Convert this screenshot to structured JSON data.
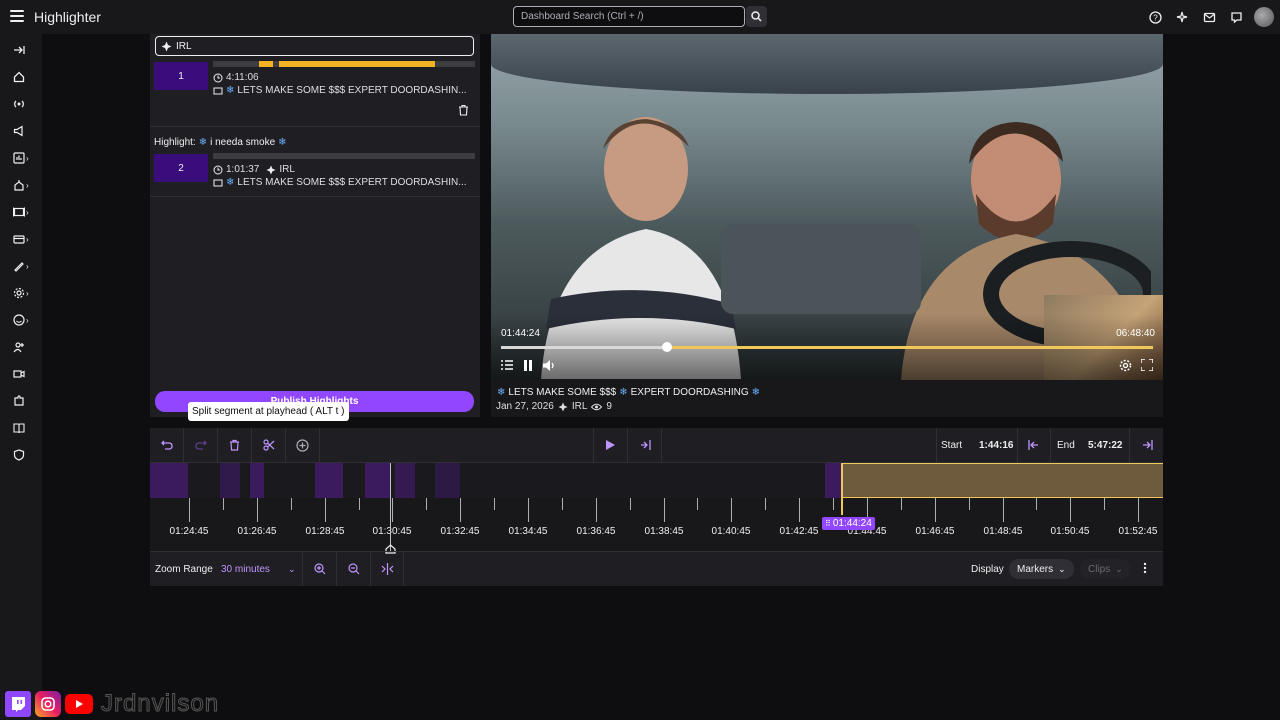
{
  "app": {
    "title": "Highlighter"
  },
  "search": {
    "placeholder": "Dashboard Search (Ctrl + /)"
  },
  "highlights": {
    "group_label": "IRL",
    "items": [
      {
        "number": "1",
        "title": "",
        "duration": "4:11:06",
        "category": "",
        "stream_title": "LETS MAKE SOME $$$  EXPERT DOORDASHIN..."
      },
      {
        "number": "2",
        "title": "i needa smoke",
        "title_prefix": "Highlight:",
        "duration": "1:01:37",
        "category": "IRL",
        "stream_title": "LETS MAKE SOME $$$  EXPERT DOORDASHIN..."
      }
    ],
    "publish_label": "Publish Highlights",
    "tooltip": "Split segment at playhead ( ALT t )"
  },
  "player": {
    "current_time": "01:44:24",
    "total_time": "06:48:40",
    "progress_fraction": 0.255
  },
  "video_info": {
    "title_a": "LETS MAKE SOME $$$",
    "title_b": "EXPERT DOORDASHING",
    "date": "Jan 27, 2026",
    "category": "IRL",
    "viewers": "9"
  },
  "editor": {
    "start_label": "Start",
    "start_value": "1:44:16",
    "end_label": "End",
    "end_value": "5:47:22"
  },
  "timeline": {
    "ticks": [
      "01:24:45",
      "01:26:45",
      "01:28:45",
      "01:30:45",
      "01:32:45",
      "01:34:45",
      "01:36:45",
      "01:38:45",
      "01:40:45",
      "01:42:45",
      "01:44:45",
      "01:46:45",
      "01:48:45",
      "01:50:45",
      "01:52:45"
    ],
    "playhead_marker": "01:44:24"
  },
  "zoom": {
    "label": "Zoom Range",
    "value": "30 minutes",
    "display_label": "Display",
    "markers_label": "Markers",
    "clips_label": "Clips"
  },
  "branding": {
    "name": "Jrdnvilson"
  },
  "colors": {
    "accent": "#9147ff",
    "clip": "#f0c75a",
    "highlight": "#3b0d7c"
  }
}
